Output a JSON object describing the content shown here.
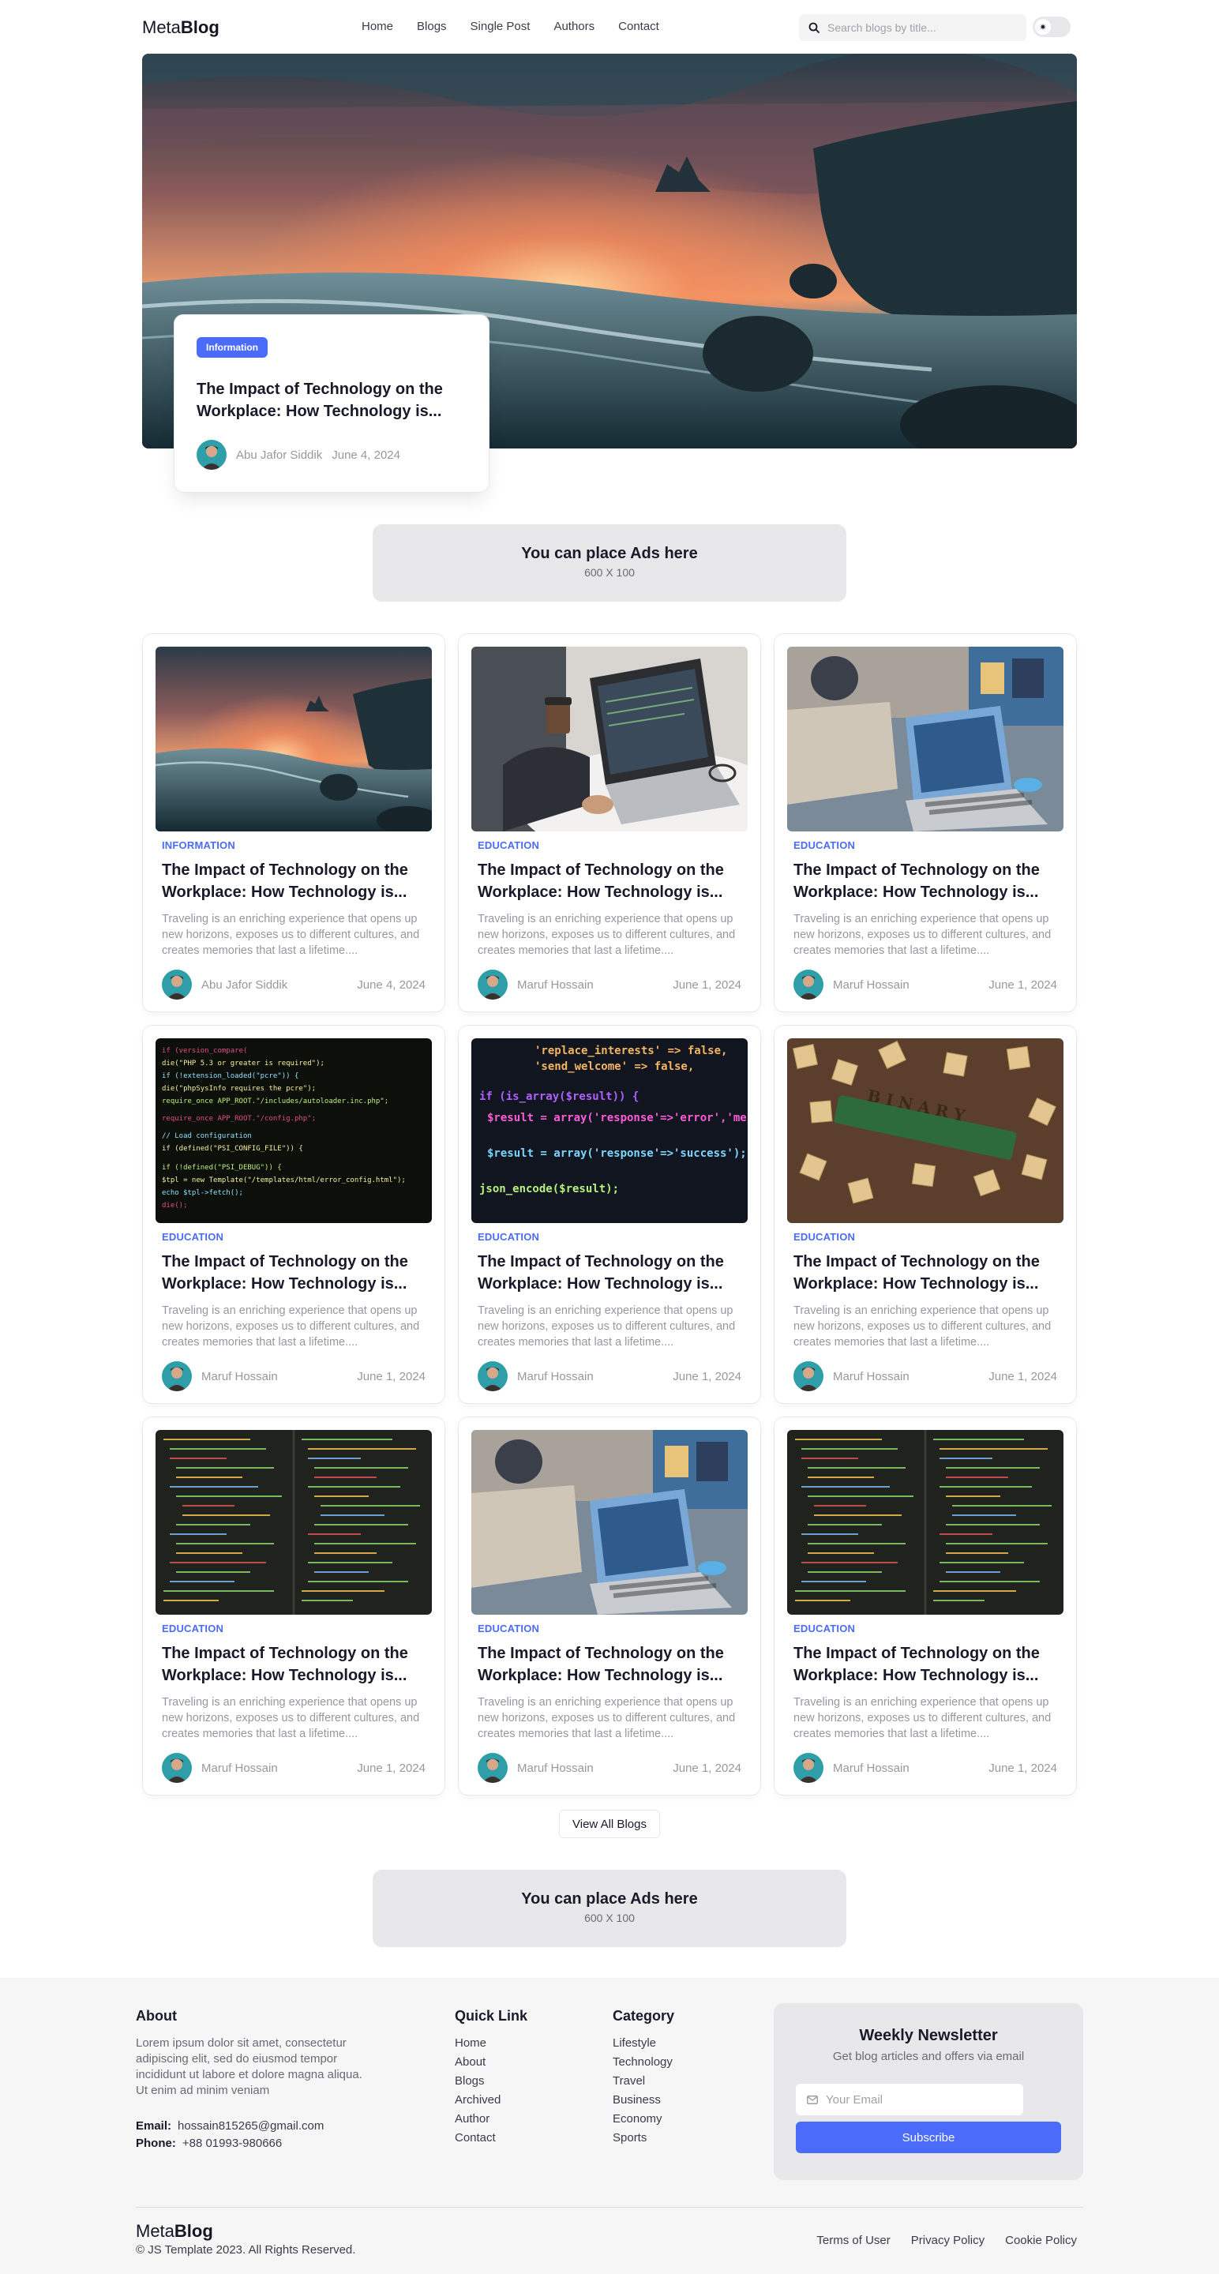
{
  "nav": {
    "logo_light": "Meta",
    "logo_bold": "Blog",
    "links": [
      "Home",
      "Blogs",
      "Single Post",
      "Authors",
      "Contact"
    ],
    "search_placeholder": "Search blogs by title...",
    "theme_icon": "sun-icon"
  },
  "hero": {
    "badge": "Information",
    "title": "The Impact of Technology on the Workplace: How Technology is...",
    "author": "Abu Jafor Siddik",
    "date": "June 4, 2024"
  },
  "ad_top": {
    "title": "You can place Ads here",
    "size": "600 X 100"
  },
  "posts": [
    {
      "category": "INFORMATION",
      "title": "The Impact of Technology on the Workplace: How Technology is...",
      "excerpt": "Traveling is an enriching experience that opens up new horizons, exposes us to different cultures, and creates memories that last a lifetime....",
      "author": "Abu Jafor Siddik",
      "date": "June 4, 2024",
      "image": "sunset-beach"
    },
    {
      "category": "EDUCATION",
      "title": "The Impact of Technology on the Workplace: How Technology is...",
      "excerpt": "Traveling is an enriching experience that opens up new horizons, exposes us to different cultures, and creates memories that last a lifetime....",
      "author": "Maruf Hossain",
      "date": "June 1, 2024",
      "image": "laptop-coffee"
    },
    {
      "category": "EDUCATION",
      "title": "The Impact of Technology on the Workplace: How Technology is...",
      "excerpt": "Traveling is an enriching experience that opens up new horizons, exposes us to different cultures, and creates memories that last a lifetime....",
      "author": "Maruf Hossain",
      "date": "June 1, 2024",
      "image": "laptop-office"
    },
    {
      "category": "EDUCATION",
      "title": "The Impact of Technology on the Workplace: How Technology is...",
      "excerpt": "Traveling is an enriching experience that opens up new horizons, exposes us to different cultures, and creates memories that last a lifetime....",
      "author": "Maruf Hossain",
      "date": "June 1, 2024",
      "image": "php-code"
    },
    {
      "category": "EDUCATION",
      "title": "The Impact of Technology on the Workplace: How Technology is...",
      "excerpt": "Traveling is an enriching experience that opens up new horizons, exposes us to different cultures, and creates memories that last a lifetime....",
      "author": "Maruf Hossain",
      "date": "June 1, 2024",
      "image": "code-closeup"
    },
    {
      "category": "EDUCATION",
      "title": "The Impact of Technology on the Workplace: How Technology is...",
      "excerpt": "Traveling is an enriching experience that opens up new horizons, exposes us to different cultures, and creates memories that last a lifetime....",
      "author": "Maruf Hossain",
      "date": "June 1, 2024",
      "image": "binary-tiles"
    },
    {
      "category": "EDUCATION",
      "title": "The Impact of Technology on the Workplace: How Technology is...",
      "excerpt": "Traveling is an enriching experience that opens up new horizons, exposes us to different cultures, and creates memories that last a lifetime....",
      "author": "Maruf Hossain",
      "date": "June 1, 2024",
      "image": "dark-code"
    },
    {
      "category": "EDUCATION",
      "title": "The Impact of Technology on the Workplace: How Technology is...",
      "excerpt": "Traveling is an enriching experience that opens up new horizons, exposes us to different cultures, and creates memories that last a lifetime....",
      "author": "Maruf Hossain",
      "date": "June 1, 2024",
      "image": "laptop-office"
    },
    {
      "category": "EDUCATION",
      "title": "The Impact of Technology on the Workplace: How Technology is...",
      "excerpt": "Traveling is an enriching experience that opens up new horizons, exposes us to different cultures, and creates memories that last a lifetime....",
      "author": "Maruf Hossain",
      "date": "June 1, 2024",
      "image": "dark-code"
    }
  ],
  "view_all": "View All Blogs",
  "ad_bottom": {
    "title": "You can place Ads here",
    "size": "600 X 100"
  },
  "footer": {
    "about_title": "About",
    "about_text": "Lorem ipsum dolor sit amet, consectetur adipiscing elit, sed do eiusmod tempor incididunt ut labore et dolore magna aliqua. Ut enim ad minim veniam",
    "email_label": "Email:",
    "email": "hossain815265@gmail.com",
    "phone_label": "Phone:",
    "phone": "+88 01993-980666",
    "quick_title": "Quick Link",
    "quick_links": [
      "Home",
      "About",
      "Blogs",
      "Archived",
      "Author",
      "Contact"
    ],
    "category_title": "Category",
    "categories": [
      "Lifestyle",
      "Technology",
      "Travel",
      "Business",
      "Economy",
      "Sports"
    ],
    "newsletter_title": "Weekly Newsletter",
    "newsletter_sub": "Get blog articles and offers via email",
    "email_placeholder": "Your Email",
    "subscribe": "Subscribe",
    "logo_light": "Meta",
    "logo_bold": "Blog",
    "copyright": "© JS Template 2023. All Rights Reserved.",
    "legal": [
      "Terms of User",
      "Privacy Policy",
      "Cookie Policy"
    ]
  },
  "colors": {
    "accent": "#4B6BFB",
    "text": "#181A2A",
    "muted": "#97989F",
    "ad_bg": "#E8E8EA",
    "footer_bg": "#F6F6F7"
  }
}
